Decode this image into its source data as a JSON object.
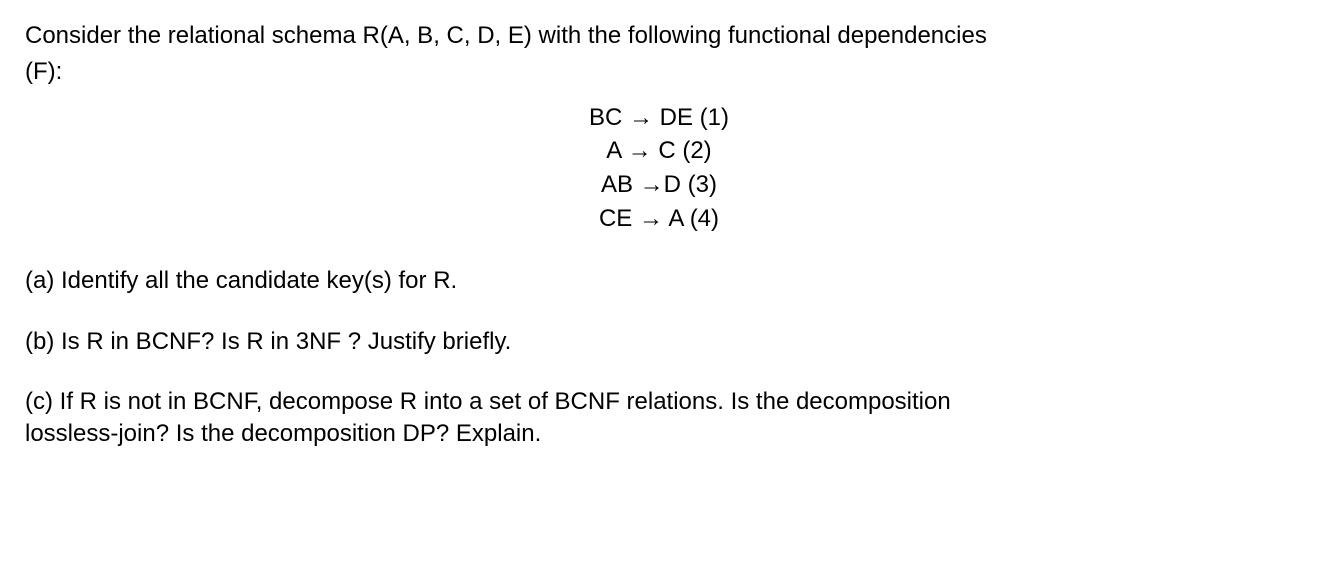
{
  "intro": {
    "line1": "Consider the relational schema R(A, B, C, D, E) with the following functional dependencies",
    "line2": "(F):"
  },
  "fds": [
    {
      "lhs": "BC",
      "arrow": "→",
      "rhs": "DE",
      "num": "(1)"
    },
    {
      "lhs": "A",
      "arrow": "→",
      "rhs": "C",
      "num": "(2)"
    },
    {
      "lhs": "AB",
      "arrow": "→",
      "rhs": "D",
      "num": "(3)"
    },
    {
      "lhs": "CE",
      "arrow": "→",
      "rhs": "A",
      "num": "(4)"
    }
  ],
  "questions": {
    "a": "(a) Identify all the candidate key(s) for R.",
    "b": "(b) Is R in BCNF? Is R in 3NF ? Justify briefly.",
    "c_line1": "(c) If R is not in BCNF, decompose R into a set of BCNF relations. Is the decomposition",
    "c_line2": "lossless-join? Is the decomposition DP? Explain."
  }
}
